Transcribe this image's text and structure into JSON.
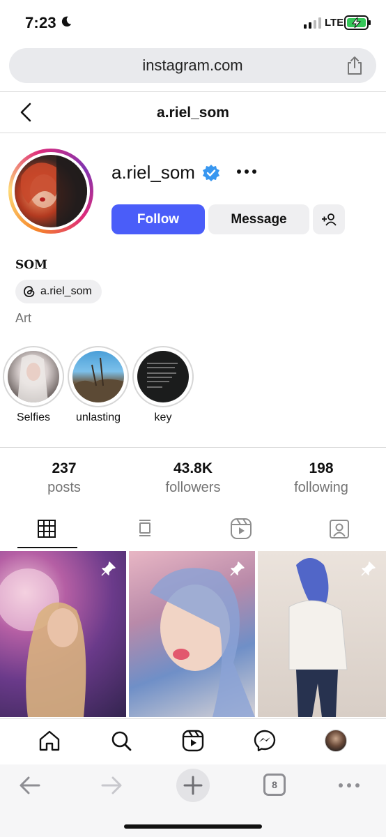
{
  "status_bar": {
    "time": "7:23",
    "network": "LTE"
  },
  "browser": {
    "url": "instagram.com",
    "tab_count": "8"
  },
  "header": {
    "title": "a.riel_som"
  },
  "profile": {
    "username": "a.riel_som",
    "verified": true,
    "follow_label": "Follow",
    "message_label": "Message",
    "full_name": "SOM",
    "threads_handle": "a.riel_som",
    "category": "Art",
    "accent_color": "#4a5df9"
  },
  "highlights": [
    {
      "label": "Selfies"
    },
    {
      "label": "unlasting"
    },
    {
      "label": "key"
    }
  ],
  "stats": {
    "posts": {
      "value": "237",
      "label": "posts"
    },
    "followers": {
      "value": "43.8K",
      "label": "followers"
    },
    "following": {
      "value": "198",
      "label": "following"
    }
  },
  "tabs": [
    {
      "icon": "grid-icon",
      "selected": true
    },
    {
      "icon": "feed-icon",
      "selected": false
    },
    {
      "icon": "reels-icon",
      "selected": false
    },
    {
      "icon": "tagged-icon",
      "selected": false
    }
  ],
  "posts": [
    {
      "pinned": true
    },
    {
      "pinned": true
    },
    {
      "pinned": true
    }
  ],
  "bottom_nav": [
    "home-icon",
    "search-icon",
    "reels-icon",
    "messenger-icon",
    "profile-avatar"
  ]
}
